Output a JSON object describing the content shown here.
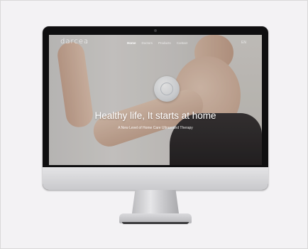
{
  "site": {
    "logo": "darcea",
    "nav": [
      "Home",
      "Doctors",
      "Products",
      "Contact"
    ],
    "active_nav": "Home",
    "lang": "EN"
  },
  "hero": {
    "headline": "Healthy life, It starts at home",
    "subline": "A New Level of Home Care Ultrasound Therapy"
  }
}
